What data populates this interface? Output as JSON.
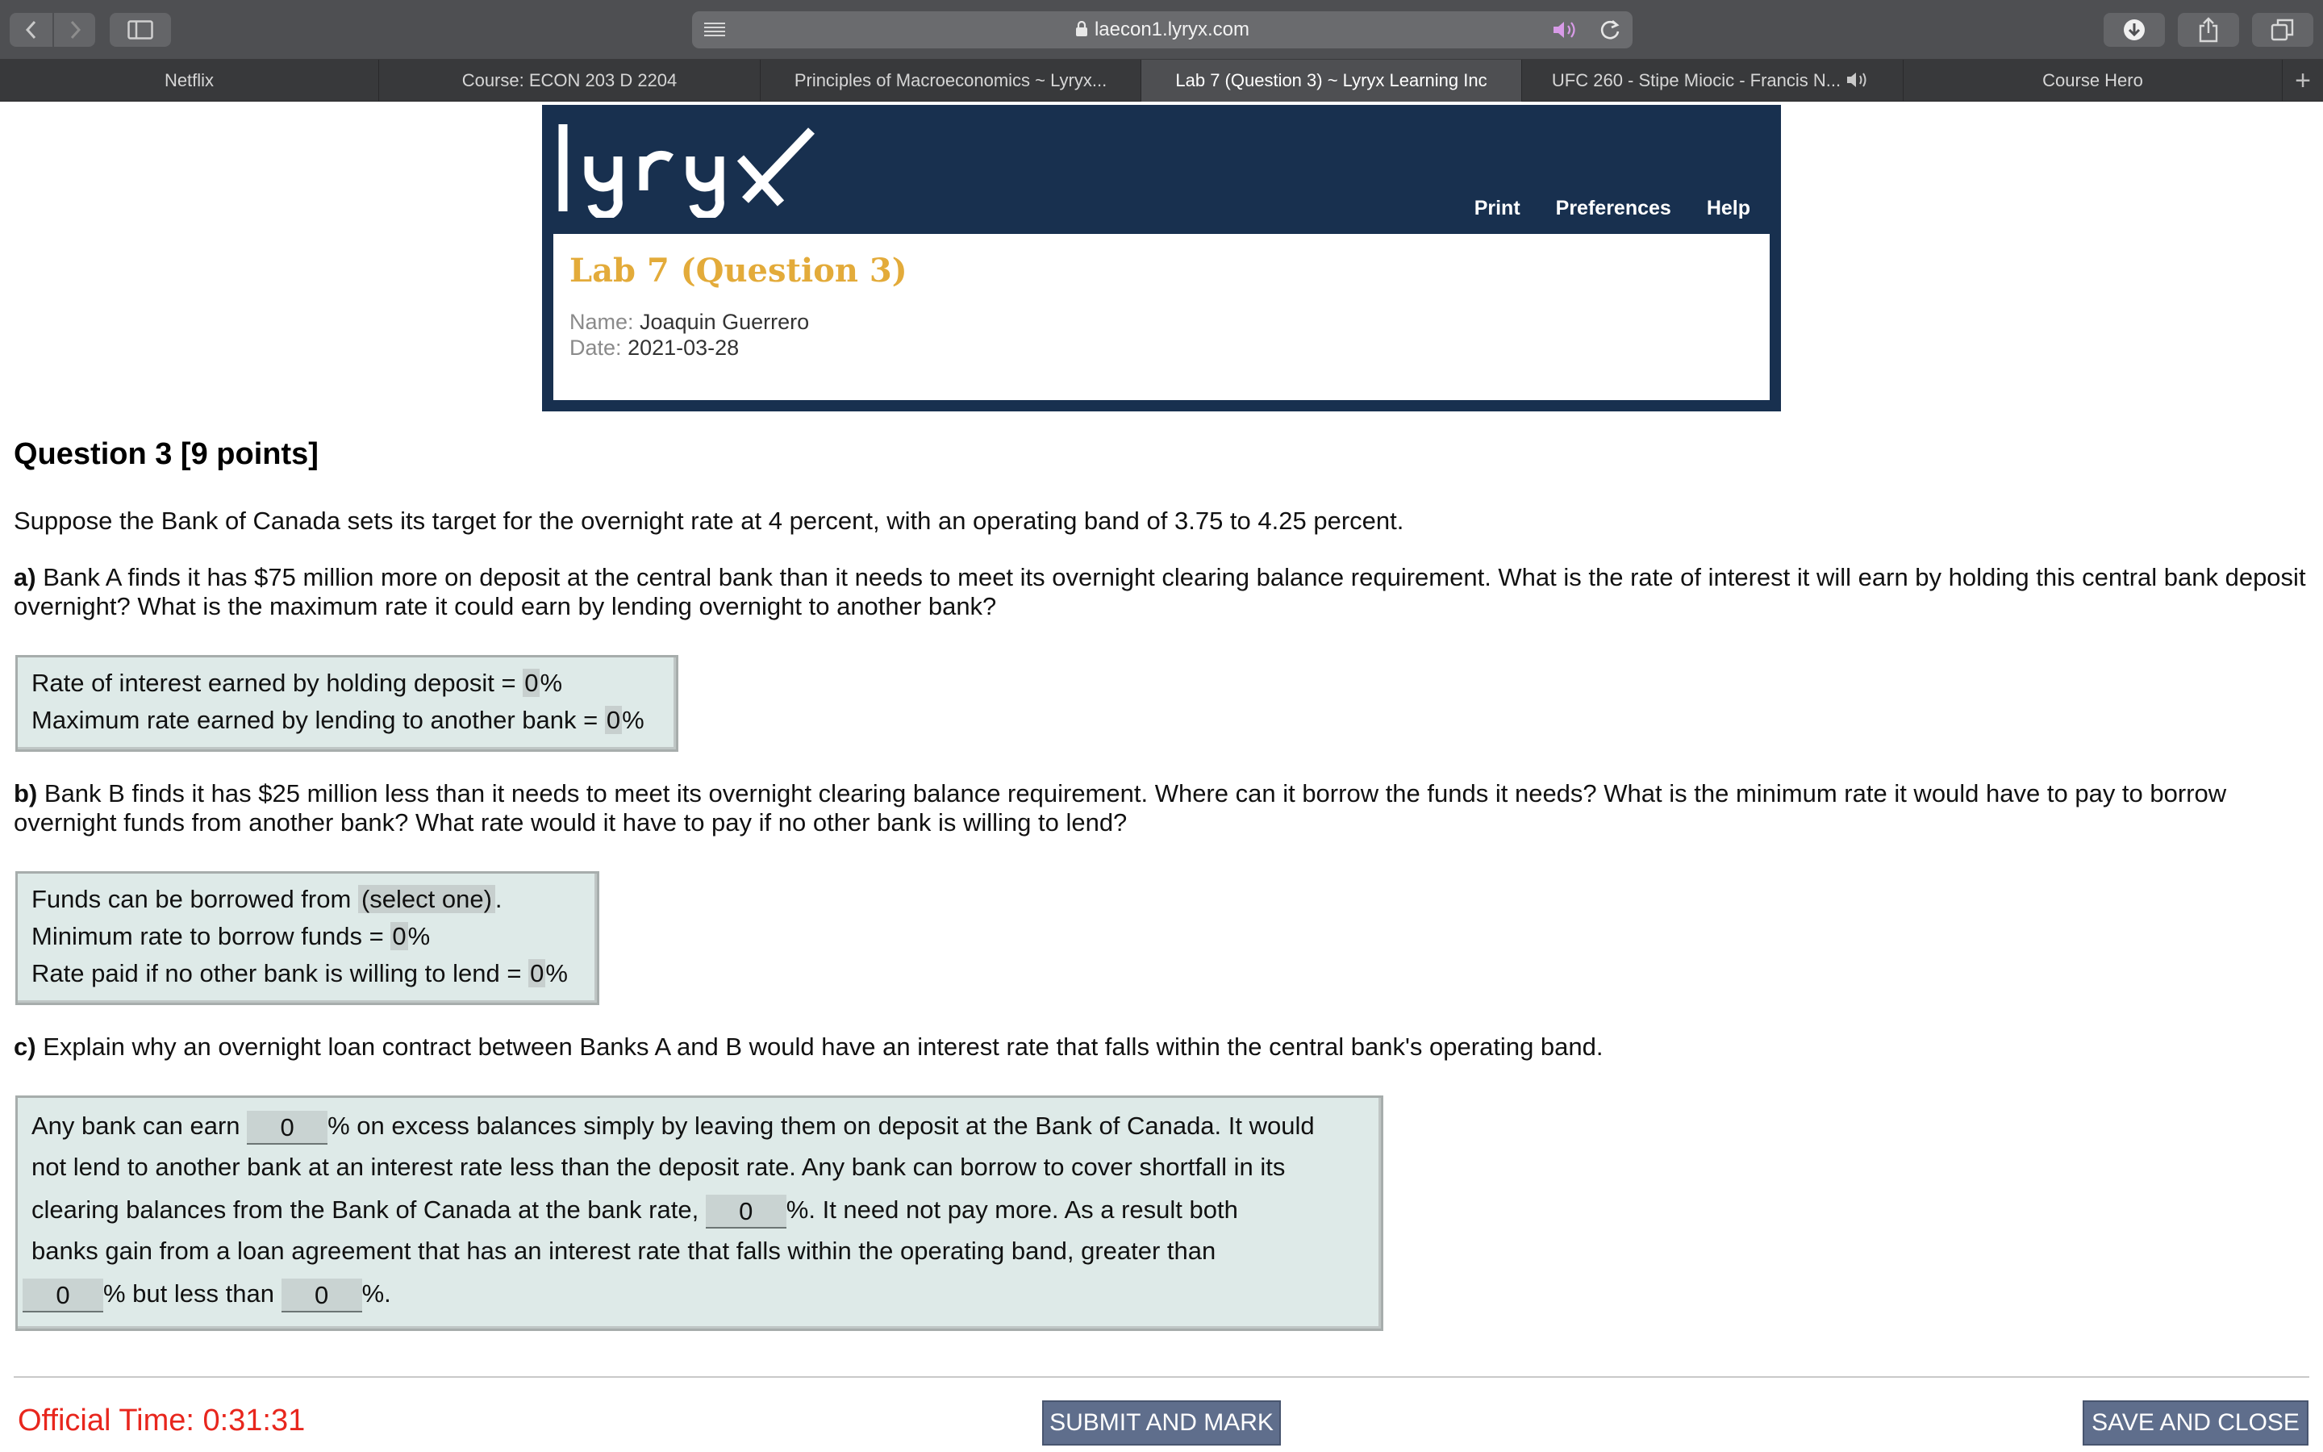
{
  "browser": {
    "url": "laecon1.lyryx.com",
    "tabs": [
      {
        "label": "Netflix"
      },
      {
        "label": "Course: ECON 203 D 2204"
      },
      {
        "label": "Principles of Macroeconomics ~ Lyryx..."
      },
      {
        "label": "Lab 7 (Question 3) ~ Lyryx Learning Inc"
      },
      {
        "label": "UFC 260 - Stipe Miocic - Francis N..."
      },
      {
        "label": "Course Hero"
      }
    ],
    "new_tab_label": "+"
  },
  "header": {
    "logo_text": "lyryx",
    "links": [
      "Print",
      "Preferences",
      "Help"
    ],
    "lab_title": "Lab 7 (Question 3)",
    "name_label": "Name:",
    "name_value": "Joaquin Guerrero",
    "date_label": "Date:",
    "date_value": "2021-03-28"
  },
  "question": {
    "title": "Question 3 [9 points]",
    "intro": "Suppose the Bank of Canada sets its target for the overnight rate at 4 percent, with an operating band of 3.75 to 4.25 percent.",
    "part_a": {
      "label": "a)",
      "text": "Bank A finds it has $75 million more on deposit at the central bank than it needs to meet its overnight clearing balance requirement. What is the rate of interest it will earn by holding this central bank deposit overnight? What is the maximum rate it could earn by lending overnight to another bank?",
      "rows": [
        {
          "label": "Rate of interest earned by holding deposit = ",
          "value": "0",
          "unit": "%"
        },
        {
          "label": "Maximum rate earned by lending to another bank = ",
          "value": "0",
          "unit": "%"
        }
      ]
    },
    "part_b": {
      "label": "b)",
      "text": "Bank B finds it has $25 million less than it needs to meet its overnight clearing balance requirement. Where can it borrow the funds it needs? What is the minimum rate it would have to pay to borrow overnight funds from another bank? What rate would it have to pay if no other bank is willing to lend?",
      "borrow_label": "Funds can be borrowed from ",
      "borrow_select": "(select one)",
      "borrow_end": ".",
      "rows": [
        {
          "label": "Minimum rate to borrow funds = ",
          "value": "0",
          "unit": "%"
        },
        {
          "label": "Rate paid if no other bank is willing to lend = ",
          "value": "0",
          "unit": "%"
        }
      ]
    },
    "part_c": {
      "label": "c)",
      "text": "Explain why an overnight loan contract between Banks A and B would have an interest rate that falls within the central bank's operating band.",
      "line1_a": "Any bank can earn ",
      "field1": "0",
      "line1_b": "% on excess balances simply by leaving them on deposit at the Bank of Canada. It would",
      "line2": "not lend to another bank at an interest rate less than the deposit rate. Any bank can borrow to cover shortfall in its",
      "line3_a": "clearing balances from the Bank of Canada at the bank rate, ",
      "field2": "0",
      "line3_b": "%. It need not pay more. As a result both",
      "line4": "banks gain from a loan agreement that has an interest rate that falls within the operating band, greater than",
      "field3": "0",
      "line5_a": "% but less than ",
      "field4": "0",
      "line5_b": "%."
    }
  },
  "footer": {
    "timer": "Official Time: 0:31:31",
    "submit_label": "SUBMIT AND MARK",
    "save_label": "SAVE AND CLOSE"
  },
  "colors": {
    "header_bg": "#18304f",
    "lab_title": "#e3ab3a",
    "answer_bg": "#deeae8",
    "timer": "#e8261d",
    "button_bg": "#5f6e8c"
  }
}
